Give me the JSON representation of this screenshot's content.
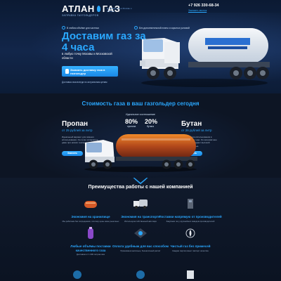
{
  "header": {
    "logo_text_a": "АТЛАН",
    "logo_text_b": "ГАЗ",
    "logo_sub": "ЗАПРАВКА ГАЗГОЛЬДЕРОВ",
    "logo_tag": "Доставка газа в Москве и области",
    "phone": "+7 926 330-68-34",
    "phone_link": "Заказать звонок"
  },
  "hero": {
    "feature_1": "В любом объёме для частных",
    "feature_2": "Без дополнительной платы и скрытых условий",
    "title": "Доставим газ за 4 часа",
    "subtitle": "в любую точку Москвы и Московской области",
    "button": "Заказать доставку газа в газгольдер",
    "note": "Доставка газа всегда по актуальным ценам"
  },
  "price": {
    "title": "Стоимость газа в ваш газгольдер сегодня",
    "ratio_label": "Идеальное соотношение",
    "pct_left": "80%",
    "pct_left_label": "пропана",
    "pct_right": "20%",
    "pct_right_label": "бутана",
    "propane": {
      "name": "Пропан",
      "price": "от 25 рублей за литр",
      "desc": "Идеальный вариант для зимнего использования. Он легко испаряется даже при низких температурах.",
      "button": "Заказать"
    },
    "butane": {
      "name": "Бутан",
      "price": "от 26 рублей за литр",
      "desc": "Подходит для использования в теплое время года. Он экономичнее пропана и обладает высокой теплотворностью.",
      "button": "Заказать"
    }
  },
  "benefits": {
    "title": "Преимущества работы с нашей компанией",
    "items": [
      {
        "head": "Экономия на хранилище",
        "text": "Мы работаем без посредников, поэтому цены ниже рыночных"
      },
      {
        "head": "Экономия на транспорте",
        "text": "Используем собственный автопарк"
      },
      {
        "head": "Поставки напрямую от производителей",
        "text": "Закупаем газ у крупнейших заводов-производителей"
      },
      {
        "head": "Любые объёмы поставки качественного газа",
        "text": "Доставим от 1 000 литров газа"
      },
      {
        "head": "Оплата удобным для вас способом",
        "text": "Принимаем наличные, безналичный расчёт"
      },
      {
        "head": "Чистый газ без примесей",
        "text": "Каждая партия имеет паспорт качества"
      }
    ]
  },
  "colors": {
    "accent": "#2aa8ff",
    "bg_dark": "#0d1524",
    "hero_bg": "#12264a"
  }
}
